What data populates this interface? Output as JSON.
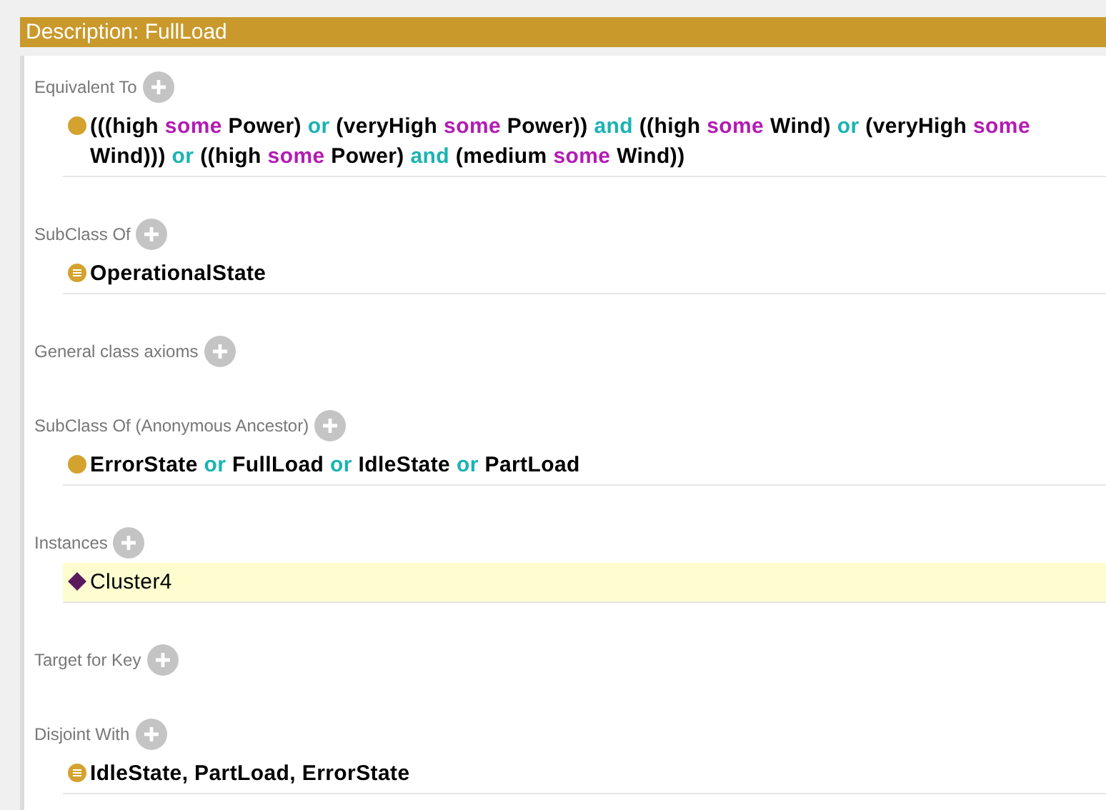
{
  "header": {
    "title": "Description: FullLoad"
  },
  "sections": [
    {
      "label": "Equivalent To",
      "items": [
        {
          "kind": "expression",
          "selected": false,
          "tokens": [
            {
              "kind": "name",
              "text": "(((high"
            },
            {
              "kind": "quantifier",
              "text": "some"
            },
            {
              "kind": "name",
              "text": "Power)"
            },
            {
              "kind": "connective",
              "text": "or"
            },
            {
              "kind": "name",
              "text": "(veryHigh"
            },
            {
              "kind": "quantifier",
              "text": "some"
            },
            {
              "kind": "name",
              "text": "Power))"
            },
            {
              "kind": "connective",
              "text": "and"
            },
            {
              "kind": "name",
              "text": "((high"
            },
            {
              "kind": "quantifier",
              "text": "some"
            },
            {
              "kind": "name",
              "text": "Wind)"
            },
            {
              "kind": "connective",
              "text": "or"
            },
            {
              "kind": "name",
              "text": "(veryHigh"
            },
            {
              "kind": "quantifier",
              "text": "some"
            },
            {
              "kind": "name",
              "text": "Wind)))"
            },
            {
              "kind": "connective",
              "text": "or"
            },
            {
              "kind": "name",
              "text": "((high"
            },
            {
              "kind": "quantifier",
              "text": "some"
            },
            {
              "kind": "name",
              "text": "Power)"
            },
            {
              "kind": "connective",
              "text": "and"
            },
            {
              "kind": "name",
              "text": "(medium"
            },
            {
              "kind": "quantifier",
              "text": "some"
            },
            {
              "kind": "name",
              "text": "Wind))"
            }
          ]
        }
      ]
    },
    {
      "label": "SubClass Of",
      "items": [
        {
          "kind": "class",
          "selected": false,
          "tokens": [
            {
              "kind": "name",
              "text": "OperationalState"
            }
          ]
        }
      ]
    },
    {
      "label": "General class axioms"
    },
    {
      "label": "SubClass Of (Anonymous Ancestor)",
      "items": [
        {
          "kind": "expression",
          "selected": false,
          "tokens": [
            {
              "kind": "name",
              "text": "ErrorState"
            },
            {
              "kind": "connective",
              "text": "or"
            },
            {
              "kind": "name",
              "text": "FullLoad"
            },
            {
              "kind": "connective",
              "text": "or"
            },
            {
              "kind": "name",
              "text": "IdleState"
            },
            {
              "kind": "connective",
              "text": "or"
            },
            {
              "kind": "name",
              "text": "PartLoad"
            }
          ]
        }
      ]
    },
    {
      "label": "Instances",
      "items": [
        {
          "kind": "individual",
          "selected": true,
          "tokens": [
            {
              "kind": "plain",
              "text": "Cluster4"
            }
          ]
        }
      ]
    },
    {
      "label": "Target for Key"
    },
    {
      "label": "Disjoint With",
      "items": [
        {
          "kind": "class",
          "selected": false,
          "tokens": [
            {
              "kind": "name",
              "text": "IdleState, PartLoad, ErrorState"
            }
          ]
        }
      ]
    }
  ]
}
